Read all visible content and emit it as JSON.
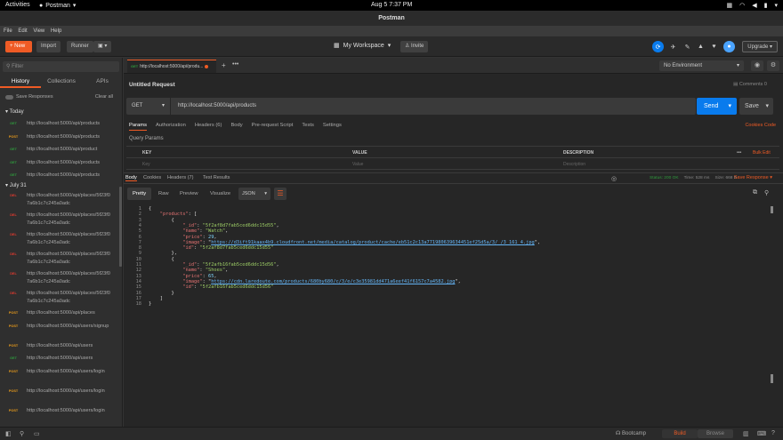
{
  "gnome": {
    "activities": "Activities",
    "app": "Postman",
    "clock": "Aug 5  7:37 PM"
  },
  "window": {
    "title": "Postman"
  },
  "menu": [
    "File",
    "Edit",
    "View",
    "Help"
  ],
  "toolbar": {
    "new": "New",
    "import": "Import",
    "runner": "Runner",
    "workspace": "My Workspace",
    "invite": "Invite",
    "upgrade": "Upgrade"
  },
  "sidebar": {
    "filter_placeholder": "Filter",
    "tabs": [
      "History",
      "Collections",
      "APIs"
    ],
    "save_responses": "Save Responses",
    "clear_all": "Clear all",
    "today": "Today",
    "july31": "July 31",
    "today_items": [
      {
        "method": "GET",
        "url": "http://localhost:5000/api/products"
      },
      {
        "method": "POST",
        "url": "http://localhost:5000/api/products"
      },
      {
        "method": "GET",
        "url": "http://localhost:5000/api/product"
      },
      {
        "method": "GET",
        "url": "http://localhost:5000/api/products"
      },
      {
        "method": "GET",
        "url": "http://localhost:5000/api/products"
      }
    ],
    "july_items": [
      {
        "method": "DEL",
        "url": "http://localhost:5000/api/places/5f23f07a6b1c7c245a0adc"
      },
      {
        "method": "DEL",
        "url": "http://localhost:5000/api/places/5f23f07a6b1c7c245a0adc"
      },
      {
        "method": "DEL",
        "url": "http://localhost:5000/api/places/5f23f07a6b1c7c245a0adc"
      },
      {
        "method": "DEL",
        "url": "http://localhost:5000/api/places/5f23f07a6b1c7c245a0adc"
      },
      {
        "method": "DEL",
        "url": "http://localhost:5000/api/places/5f23f07a6b1c7c245a0adc"
      },
      {
        "method": "DEL",
        "url": "http://localhost:5000/api/places/5f23f07a6b1c7c245a0adc"
      },
      {
        "method": "POST",
        "url": "http://localhost:5000/api/places"
      },
      {
        "method": "POST",
        "url": "http://localhost:5000/api/users/signup"
      },
      {
        "method": "POST",
        "url": "http://localhost:5000/api/users"
      },
      {
        "method": "GET",
        "url": "http://localhost:5000/api/users"
      },
      {
        "method": "POST",
        "url": "http://localhost:5000/api/users/login"
      },
      {
        "method": "POST",
        "url": "http://localhost:5000/api/users/login"
      },
      {
        "method": "POST",
        "url": "http://localhost:5000/api/users/login"
      }
    ]
  },
  "request": {
    "tab_method": "GET",
    "tab_url": "http://localhost:5000/api/produ...",
    "environment": "No Environment",
    "name": "Untitled Request",
    "comments": "Comments 0",
    "method": "GET",
    "url": "http://localhost:5000/api/products",
    "send": "Send",
    "save": "Save",
    "tabs": [
      "Params",
      "Authorization",
      "Headers (6)",
      "Body",
      "Pre-request Script",
      "Tests",
      "Settings"
    ],
    "cookies_code": "Cookies  Code",
    "query_params": "Query Params",
    "param_headers": [
      "KEY",
      "VALUE",
      "DESCRIPTION"
    ],
    "param_placeholders": [
      "Key",
      "Value",
      "Description"
    ],
    "bulk_edit": "Bulk Edit"
  },
  "response": {
    "tabs": [
      "Body",
      "Cookies",
      "Headers (7)",
      "Test Results"
    ],
    "status": "Status: 200 OK",
    "time": "Time: 528 ms",
    "size": "Size: 668 B",
    "save_response": "Save Response",
    "formats": [
      "Pretty",
      "Raw",
      "Preview",
      "Visualize"
    ],
    "format_sel": "JSON",
    "lines": [
      "{",
      "    \"products\": [",
      "        {",
      "            \"_id\": \"5f2af8d7fab5ced6ddc15d55\",",
      "            \"name\": \"Watch\",",
      "            \"price\": 29,",
      "            \"image\": \"https://d3ift91kaax4b9.cloudfront.net/media/catalog/product/cache/eb51c2c13a771980639634451ef25d5a/3/_/3_161_4.jpg\",",
      "            \"id\": \"5f2af8d7fab5ced6ddc15d55\"",
      "        },",
      "        {",
      "            \"_id\": \"5f2afb16fab5ced6ddc15d56\",",
      "            \"name\": \"Shoes\",",
      "            \"price\": 65,",
      "            \"image\": \"https://cdn.laredoute.com/products/680by680/c/3/e/c3e35981dd471a6eef41f6157c7a4582.jpg\",",
      "            \"id\": \"5f2afb16fab5ced6ddc15d56\"",
      "        }",
      "    ]",
      "}"
    ]
  },
  "statusbar": {
    "bootcamp": "Bootcamp",
    "build": "Build",
    "browse": "Browse"
  },
  "colors": {
    "accent": "#ef5b25",
    "send": "#097bed",
    "get": "#2f9a3d",
    "post": "#ea9c1b",
    "del": "#e03a2f"
  }
}
